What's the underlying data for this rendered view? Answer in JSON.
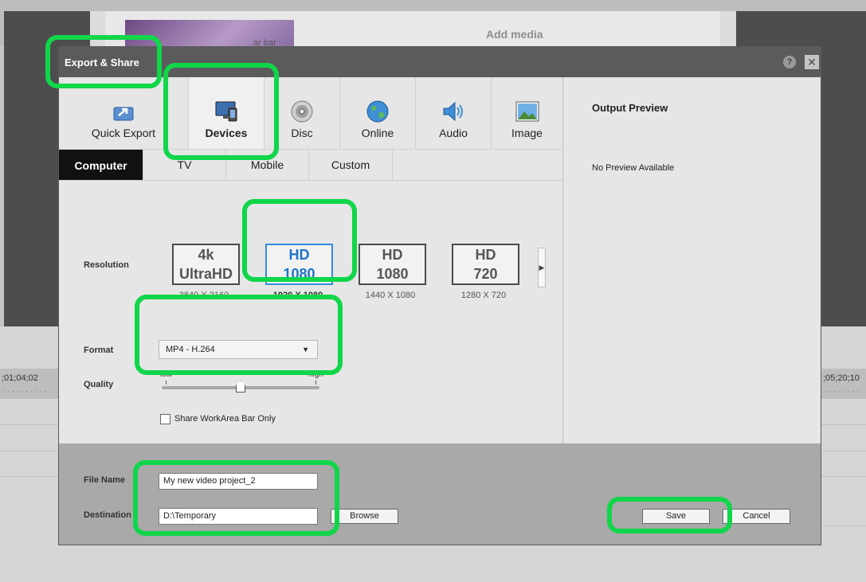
{
  "background": {
    "add_media": "Add media",
    "thumb_text": "ar bar",
    "timecode_left": ";01;04;02",
    "timecode_right": ";05;20;10"
  },
  "dialog": {
    "title": "Export & Share",
    "help": "?",
    "close": "✕"
  },
  "category_tabs": [
    {
      "label": "Quick Export",
      "icon": "quick-export-icon"
    },
    {
      "label": "Devices",
      "icon": "devices-icon",
      "active": true
    },
    {
      "label": "Disc",
      "icon": "disc-icon"
    },
    {
      "label": "Online",
      "icon": "globe-icon"
    },
    {
      "label": "Audio",
      "icon": "speaker-icon"
    },
    {
      "label": "Image",
      "icon": "image-icon"
    }
  ],
  "sub_tabs": [
    {
      "label": "Computer",
      "active": true
    },
    {
      "label": "TV"
    },
    {
      "label": "Mobile"
    },
    {
      "label": "Custom"
    }
  ],
  "resolution": {
    "label": "Resolution",
    "presets": [
      {
        "line1": "4k",
        "line2": "UltraHD",
        "size": "3840 X 2160"
      },
      {
        "line1": "HD",
        "line2": "1080",
        "size": "1920 X 1080",
        "selected": true
      },
      {
        "line1": "HD",
        "line2": "1080",
        "size": "1440 X 1080"
      },
      {
        "line1": "HD",
        "line2": "720",
        "size": "1280 X 720"
      }
    ],
    "scroll_icon": "chevron-right-icon"
  },
  "format": {
    "label": "Format",
    "value": "MP4 - H.264"
  },
  "quality": {
    "label": "Quality",
    "low": "low",
    "high": "high",
    "level_fraction": 0.5
  },
  "share_workarea": {
    "label": "Share WorkArea Bar Only",
    "checked": false
  },
  "output_preview": {
    "title": "Output Preview",
    "empty": "No Preview Available"
  },
  "footer": {
    "file_name_label": "File Name",
    "file_name_value": "My new video project_2",
    "destination_label": "Destination",
    "destination_value": "D:\\Temporary",
    "browse": "Browse",
    "save": "Save",
    "cancel": "Cancel"
  },
  "colors": {
    "highlight": "#10d64a",
    "selected_preset": "#1e73c8",
    "titlebar": "#5b5b5b"
  }
}
